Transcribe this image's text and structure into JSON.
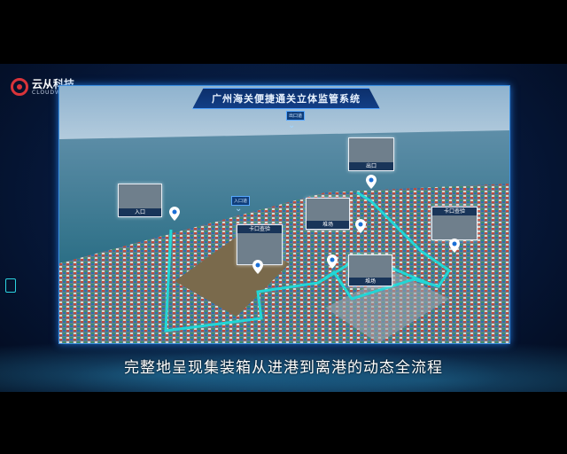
{
  "brand": {
    "name": "云从科技",
    "sub": "CLOUDWALK"
  },
  "panel": {
    "title": "广州海关便捷通关立体监管系统"
  },
  "map_labels": {
    "exit_tag": "出口道",
    "entry_tag": "入口道"
  },
  "cards": {
    "entrance": "入口",
    "exit": "出口",
    "checkpoint1": "卡口查验",
    "checkpoint2": "卡口查验",
    "yard1": "堆场",
    "yard2": "堆场"
  },
  "subtitle": "完整地呈现集装箱从进港到离港的动态全流程",
  "colors": {
    "route": "#22d6d6",
    "frame": "#3b8fe0",
    "brand_red": "#d9343a"
  }
}
